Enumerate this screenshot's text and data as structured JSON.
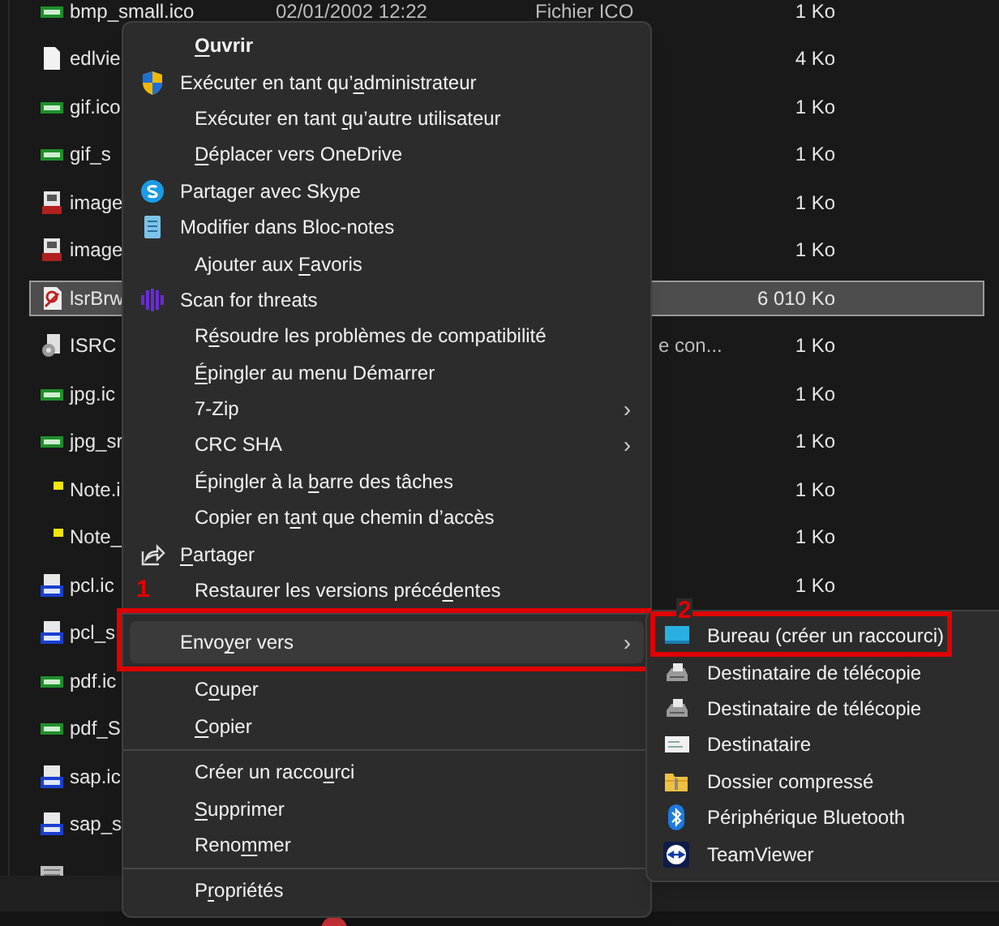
{
  "file_list": {
    "rows": [
      {
        "kind": "tag-green",
        "name": "bmp_small.ico",
        "date": "02/01/2002 12:22",
        "type": "Fichier ICO",
        "size": "1 Ko",
        "selected": false
      },
      {
        "kind": "page",
        "name": "edlvie",
        "size": "4 Ko",
        "selected": false
      },
      {
        "kind": "tag-green",
        "name": "gif.ico",
        "size": "1 Ko",
        "selected": false
      },
      {
        "kind": "tag-green",
        "name": "gif_s",
        "size": "1 Ko",
        "selected": false
      },
      {
        "kind": "image",
        "name": "image",
        "size": "1 Ko",
        "selected": false
      },
      {
        "kind": "image",
        "name": "image",
        "size": "1 Ko",
        "selected": false
      },
      {
        "kind": "app",
        "name": "lsrBrw",
        "size": "6 010 Ko",
        "selected": true
      },
      {
        "kind": "settings",
        "name": "ISRC",
        "type_fragment": "e con...",
        "size": "1 Ko",
        "selected": false
      },
      {
        "kind": "tag-green",
        "name": "jpg.ic",
        "size": "1 Ko",
        "selected": false
      },
      {
        "kind": "tag-green",
        "name": "jpg_sr",
        "size": "1 Ko",
        "selected": false
      },
      {
        "kind": "note",
        "name": "Note.i",
        "size": "1 Ko",
        "selected": false
      },
      {
        "kind": "note",
        "name": "Note_",
        "size": "1 Ko",
        "selected": false
      },
      {
        "kind": "tag-blue",
        "name": "pcl.ic",
        "size": "1 Ko",
        "selected": false
      },
      {
        "kind": "tag-blue",
        "name": "pcl_s",
        "selected": false
      },
      {
        "kind": "tag-green",
        "name": "pdf.ic",
        "selected": false
      },
      {
        "kind": "tag-green",
        "name": "pdf_S",
        "selected": false
      },
      {
        "kind": "tag-blue",
        "name": "sap.ic",
        "selected": false
      },
      {
        "kind": "tag-blue",
        "name": "sap_s",
        "selected": false
      },
      {
        "kind": "keyboard",
        "selected": false
      }
    ]
  },
  "context_menu": {
    "items": [
      {
        "kind": "plain",
        "label": {
          "key": "O",
          "after": "uvrir"
        },
        "default": true,
        "highlighted": false
      },
      {
        "kind": "shield",
        "label": {
          "before": "Exécuter en tant qu’",
          "key": "a",
          "after": "dministrateur"
        },
        "default": false,
        "highlighted": false
      },
      {
        "kind": "plain",
        "label": {
          "before": "Exécuter en tant ",
          "key": "q",
          "after": "u’autre utilisateur"
        },
        "default": false,
        "highlighted": false
      },
      {
        "kind": "plain",
        "label": {
          "key": "D",
          "after": "éplacer vers OneDrive"
        },
        "default": false,
        "highlighted": false
      },
      {
        "kind": "skype",
        "label": {
          "before": "Partager avec Skype"
        },
        "default": false,
        "highlighted": false
      },
      {
        "kind": "notepad",
        "label": {
          "before": "Modifier dans Bloc-notes"
        },
        "default": false,
        "highlighted": false
      },
      {
        "kind": "plain",
        "label": {
          "before": "Ajouter aux ",
          "key": "F",
          "after": "avoris"
        },
        "default": false,
        "highlighted": false
      },
      {
        "kind": "scan",
        "label": {
          "before": "Scan for threats"
        },
        "default": false,
        "highlighted": false
      },
      {
        "kind": "plain",
        "label": {
          "before": "R",
          "key": "é",
          "after": "soudre les problèmes de compatibilité"
        },
        "default": false,
        "highlighted": false
      },
      {
        "kind": "plain",
        "label": {
          "key": "É",
          "after": "pingler au menu Démarrer"
        },
        "default": false,
        "highlighted": false
      },
      {
        "kind": "plain",
        "label": {
          "before": "7-Zip"
        },
        "arrow": "›",
        "default": false,
        "highlighted": false
      },
      {
        "kind": "plain",
        "label": {
          "before": "CRC SHA"
        },
        "arrow": "›",
        "default": false,
        "highlighted": false
      },
      {
        "kind": "plain",
        "label": {
          "before": "Épingler à la ",
          "key": "b",
          "after": "arre des tâches"
        },
        "default": false,
        "highlighted": false
      },
      {
        "kind": "plain",
        "label": {
          "before": "Copier en t",
          "key": "a",
          "after": "nt que chemin d’accès"
        },
        "default": false,
        "highlighted": false
      },
      {
        "kind": "share",
        "label": {
          "key": "P",
          "after": "artager"
        },
        "default": false,
        "highlighted": false
      },
      {
        "kind": "plain",
        "label": {
          "before": "Restaurer les versions précé",
          "key": "d",
          "after": "entes"
        },
        "default": false,
        "highlighted": false
      },
      {
        "kind": "separator"
      },
      {
        "kind": "plain",
        "label": {
          "before": "Envo",
          "key": "y",
          "after": "er vers"
        },
        "arrow": "›",
        "default": false,
        "highlighted": true,
        "callout": "1"
      },
      {
        "kind": "plain",
        "label": {
          "before": "C",
          "key": "o",
          "after": "uper"
        },
        "default": false,
        "highlighted": false
      },
      {
        "kind": "plain",
        "label": {
          "key": "C",
          "after": "opier"
        },
        "default": false,
        "highlighted": false
      },
      {
        "kind": "separator"
      },
      {
        "kind": "plain",
        "label": {
          "before": "Créer un racco",
          "key": "u",
          "after": "rci"
        },
        "default": false,
        "highlighted": false
      },
      {
        "kind": "plain",
        "label": {
          "key": "S",
          "after": "upprimer"
        },
        "default": false,
        "highlighted": false
      },
      {
        "kind": "plain",
        "label": {
          "before": "Reno",
          "key": "m",
          "after": "mer"
        },
        "default": false,
        "highlighted": false
      },
      {
        "kind": "separator"
      },
      {
        "kind": "plain",
        "label": {
          "before": "P",
          "key": "r",
          "after": "opriétés"
        },
        "default": false,
        "highlighted": false
      }
    ]
  },
  "send_to_menu": {
    "items": [
      {
        "kind": "desktop",
        "label": "Bureau (créer un raccourci)",
        "callout": "2"
      },
      {
        "kind": "fax",
        "label": "Destinataire de télécopie"
      },
      {
        "kind": "fax",
        "label": "Destinataire de télécopie"
      },
      {
        "kind": "mail",
        "label": "Destinataire"
      },
      {
        "kind": "zip",
        "label": "Dossier compressé"
      },
      {
        "kind": "bluetooth",
        "label": "Périphérique Bluetooth"
      },
      {
        "kind": "teamviewer",
        "label": "TeamViewer"
      }
    ]
  }
}
